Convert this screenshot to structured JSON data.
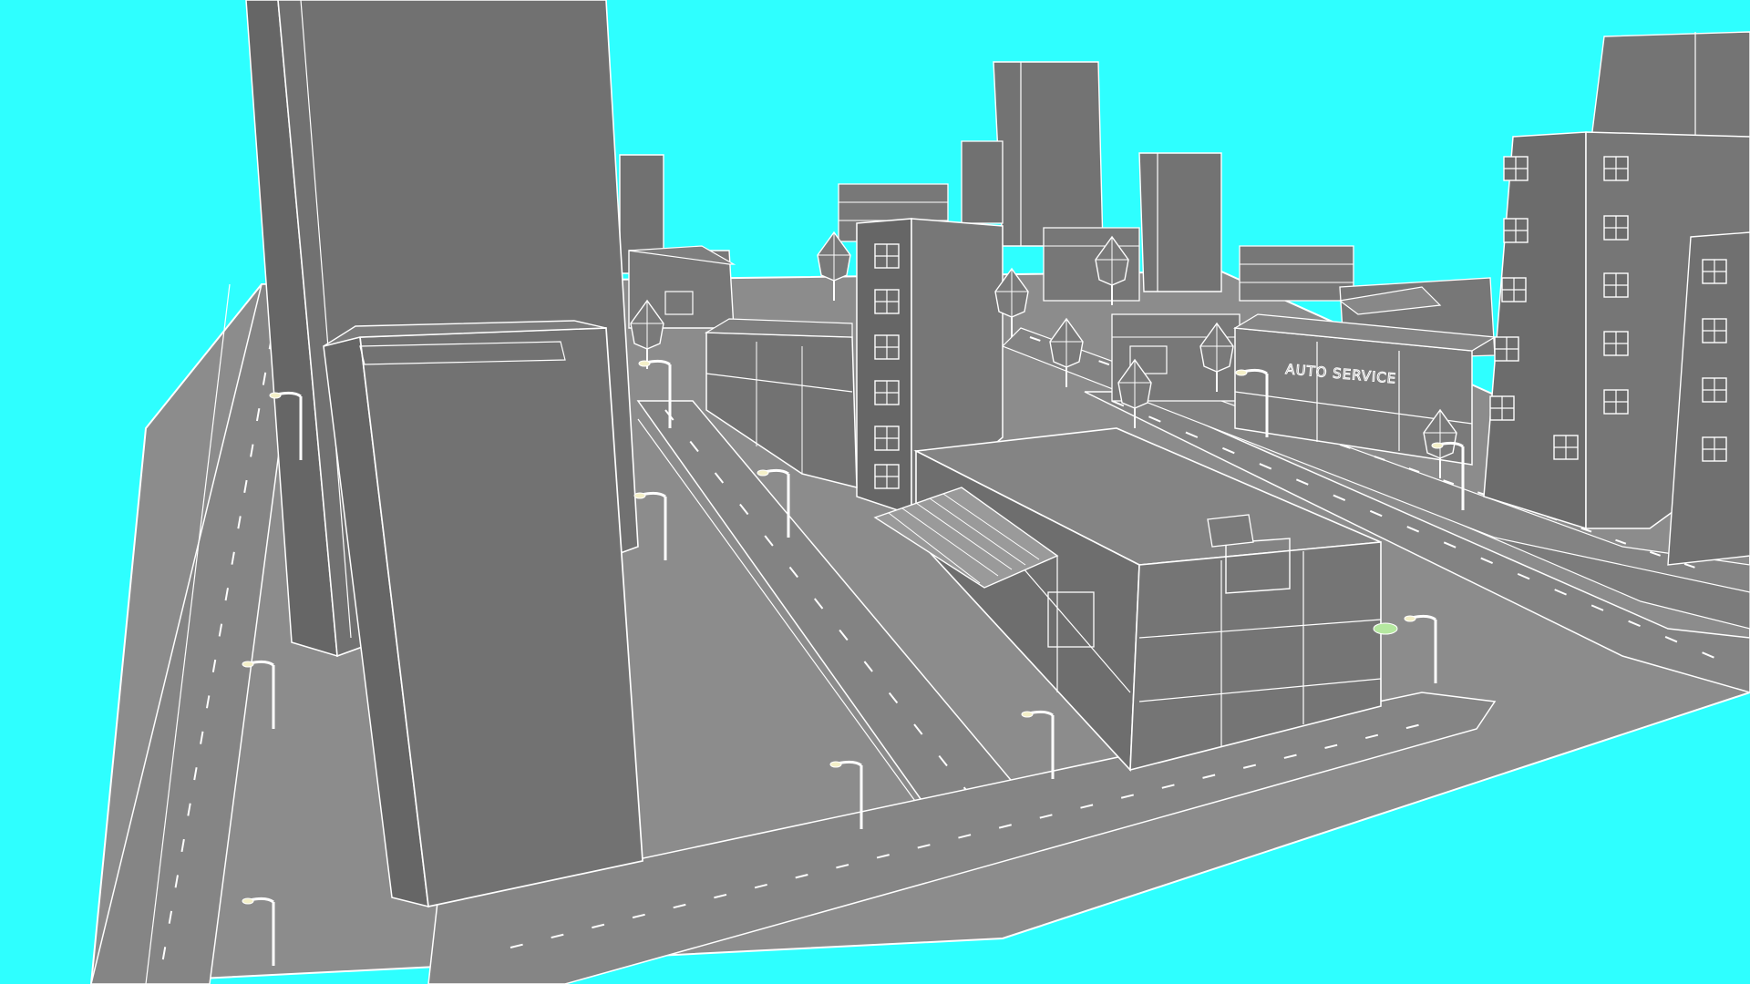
{
  "scene": {
    "description_label": "",
    "sign_text": "AUTO SERVICE",
    "colors": {
      "sky": "#2effff",
      "ground": "#8e8e8e",
      "road": "#7e7e7e",
      "building": "#777777",
      "building_dark": "#6a6a6a",
      "wire": "#ffffff"
    }
  }
}
